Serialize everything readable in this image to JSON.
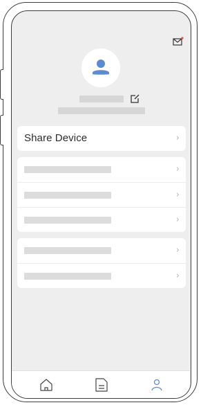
{
  "menu": {
    "share_device_label": "Share Device",
    "chevron": "›"
  },
  "icons": {
    "mail": "mail-icon",
    "edit": "edit-icon",
    "avatar": "user-avatar-icon",
    "tab_home": "home-icon",
    "tab_doc": "document-icon",
    "tab_me": "person-icon"
  },
  "colors": {
    "accent": "#5b8bd4",
    "notification_dot": "#e0533a",
    "screen_bg": "#eeeeee",
    "placeholder": "#d6d6d6"
  },
  "tabbar": {
    "selected": "tab_me"
  }
}
